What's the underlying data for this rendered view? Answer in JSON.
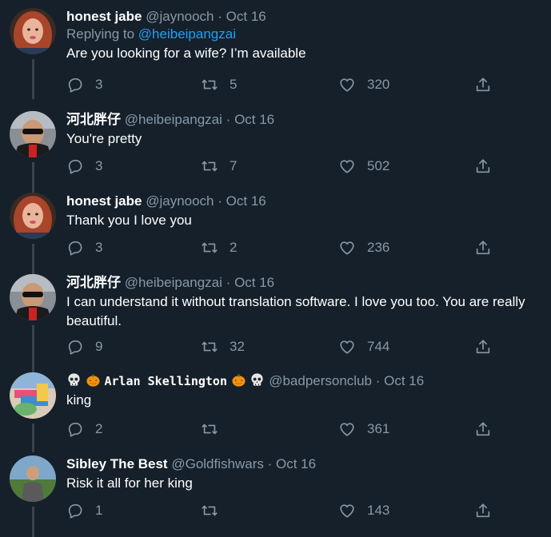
{
  "tweets": [
    {
      "name": "honest jabe",
      "handle": "@jaynooch",
      "separator": "·",
      "date": "Oct 16",
      "replying_prefix": "Replying to",
      "replying_to": "@heibeipangzai",
      "text": "Are you looking for a wife? I’m available",
      "replies": "3",
      "retweets": "5",
      "likes": "320",
      "avatar": "woman-red-hair"
    },
    {
      "name": "河北胖仔",
      "handle": "@heibeipangzai",
      "separator": "·",
      "date": "Oct 16",
      "text": "You're pretty",
      "replies": "3",
      "retweets": "7",
      "likes": "502",
      "avatar": "man-sunglasses"
    },
    {
      "name": "honest jabe",
      "handle": "@jaynooch",
      "separator": "·",
      "date": "Oct 16",
      "text": "Thank you I love you",
      "replies": "3",
      "retweets": "2",
      "likes": "236",
      "avatar": "woman-red-hair"
    },
    {
      "name": "河北胖仔",
      "handle": "@heibeipangzai",
      "separator": "·",
      "date": "Oct 16",
      "text": "I can understand it without translation software. I love you too. You are really beautiful.",
      "replies": "9",
      "retweets": "32",
      "likes": "744",
      "avatar": "man-sunglasses"
    },
    {
      "name": "Arlan Skellington",
      "handle": "@badpersonclub",
      "separator": "·",
      "date": "Oct 16",
      "text": "king",
      "replies": "2",
      "retweets": "",
      "likes": "361",
      "avatar": "colorful-photo"
    },
    {
      "name": "Sibley The Best",
      "handle": "@Goldfishwars",
      "separator": "·",
      "date": "Oct 16",
      "text": "Risk it all for her king",
      "replies": "1",
      "retweets": "",
      "likes": "143",
      "avatar": "man-outdoors"
    }
  ],
  "icons": {
    "reply": "reply-icon",
    "retweet": "retweet-icon",
    "like": "heart-icon",
    "share": "share-icon",
    "name_emoji": [
      "skull-icon",
      "pumpkin-icon"
    ]
  },
  "colors": {
    "background": "#15202b",
    "secondary_text": "#8899a6",
    "link": "#1da1f2",
    "thread_line": "#38444d"
  }
}
